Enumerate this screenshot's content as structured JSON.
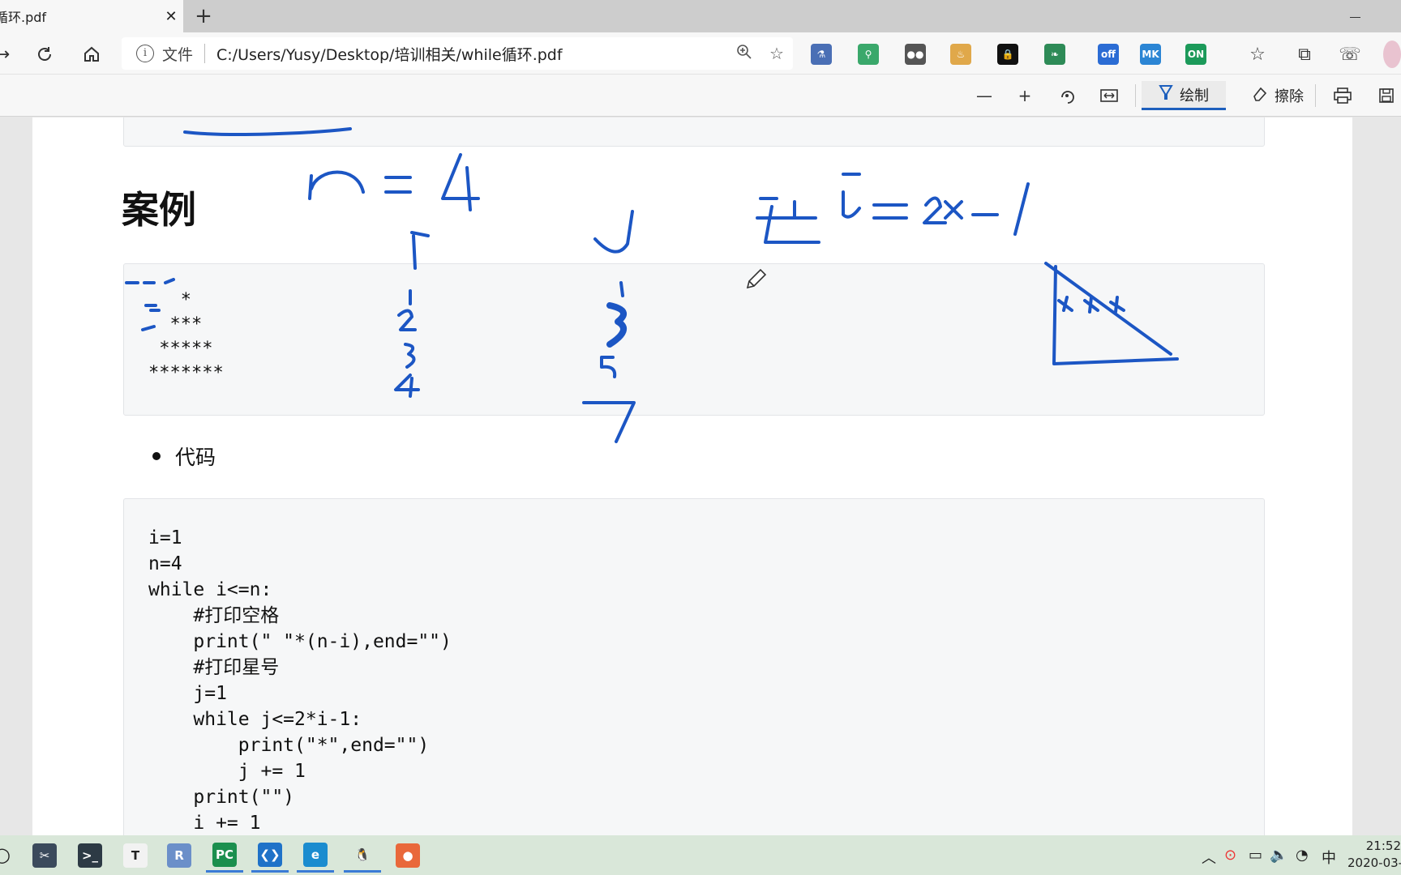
{
  "tab": {
    "title": "循环.pdf",
    "close": "✕",
    "new_tab": "+"
  },
  "address": {
    "info": "i",
    "label": "文件",
    "url": "C:/Users/Yusy/Desktop/培训相关/while循环.pdf"
  },
  "extensions": [
    {
      "name": "microscope-extension-icon",
      "glyph": "⚗",
      "color": "#4a6fb5"
    },
    {
      "name": "search-extension-icon",
      "glyph": "⚲",
      "color": "#3aa86b"
    },
    {
      "name": "tampermonkey-extension-icon",
      "glyph": "●●",
      "color": "#555555"
    },
    {
      "name": "brain-extension-icon",
      "glyph": "♨",
      "color": "#e0a84a"
    },
    {
      "name": "lock-extension-icon",
      "glyph": "🔒",
      "color": "#111111"
    },
    {
      "name": "leaf-extension-icon",
      "glyph": "❧",
      "color": "#2e8b57"
    },
    {
      "name": "off-extension-icon",
      "glyph": "off",
      "color": "#2b6cd4"
    },
    {
      "name": "mk-extension-icon",
      "glyph": "MK",
      "color": "#2b85d4"
    },
    {
      "name": "on-extension-icon",
      "glyph": "ON",
      "color": "#1c9a5a"
    }
  ],
  "pdf_toolbar": {
    "draw_label": "绘制",
    "erase_label": "擦除"
  },
  "document": {
    "heading": "案例",
    "pattern": "   *\n  ***\n *****\n*******",
    "bullet": "代码",
    "code": "i=1\nn=4\nwhile i<=n:\n    #打印空格\n    print(\" \"*(n-i),end=\"\")\n    #打印星号\n    j=1\n    while j<=2*i-1:\n        print(\"*\",end=\"\")\n        j += 1\n    print(\"\")\n    i += 1"
  },
  "annotations": {
    "n_eq": "n = 4",
    "i_col": "i",
    "i_vals": [
      "1",
      "2",
      "3",
      "4"
    ],
    "j_col": "j",
    "j_vals": [
      "1",
      "3",
      "5",
      "7"
    ],
    "formula": "空 j=2*i-1"
  },
  "taskbar": {
    "apps": [
      {
        "name": "taskbar-snip-app",
        "glyph": "✂",
        "color": "#3b4a5c"
      },
      {
        "name": "taskbar-terminal-app",
        "glyph": ">_",
        "color": "#2d3a45"
      },
      {
        "name": "taskbar-typora-app",
        "glyph": "T",
        "color": "#f2f2f2"
      },
      {
        "name": "taskbar-r-app",
        "glyph": "R",
        "color": "#6b8fc9"
      },
      {
        "name": "taskbar-pycharm-app",
        "glyph": "PC",
        "color": "#1b8f4e"
      },
      {
        "name": "taskbar-vscode-app",
        "glyph": "❮❯",
        "color": "#1f72c8"
      },
      {
        "name": "taskbar-edge-beta-app",
        "glyph": "e",
        "color": "#1b8ccf"
      },
      {
        "name": "taskbar-qq-app",
        "glyph": "🐧",
        "color": "#d9e7d9"
      },
      {
        "name": "taskbar-recorder-app",
        "glyph": "●",
        "color": "#e9683b"
      }
    ],
    "tray_ime": "中",
    "clock_time": "21:52",
    "clock_date": "2020-03-"
  },
  "colors": {
    "ink": "#1c56c4",
    "accent": "#1d5fbd"
  }
}
